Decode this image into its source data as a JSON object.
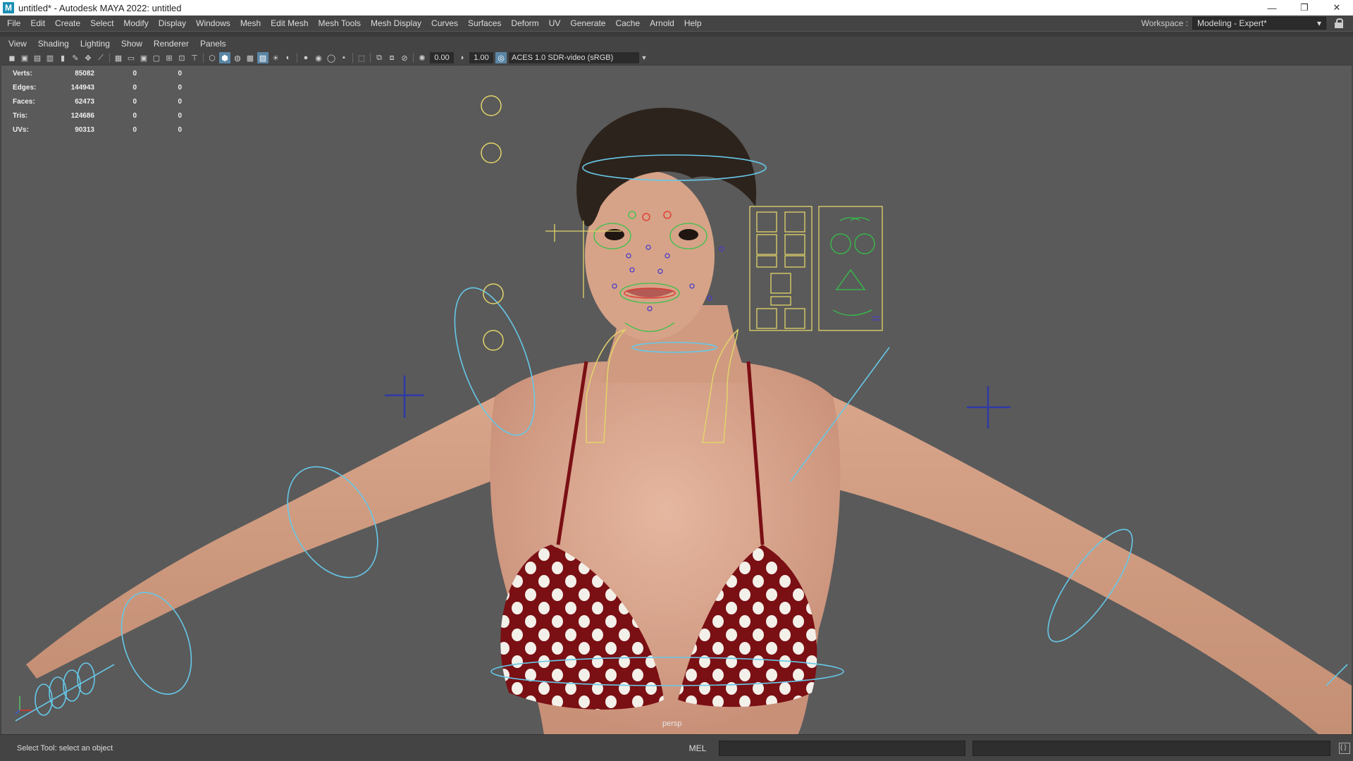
{
  "window": {
    "title": "untitled* - Autodesk MAYA 2022: untitled",
    "app_icon": "M",
    "minimize": "—",
    "maximize": "❐",
    "close": "✕"
  },
  "menubar": {
    "items": [
      "File",
      "Edit",
      "Create",
      "Select",
      "Modify",
      "Display",
      "Windows",
      "Mesh",
      "Edit Mesh",
      "Mesh Tools",
      "Mesh Display",
      "Curves",
      "Surfaces",
      "Deform",
      "UV",
      "Generate",
      "Cache",
      "Arnold",
      "Help"
    ],
    "workspace_label": "Workspace :",
    "workspace_value": "Modeling - Expert*"
  },
  "panel_menu": [
    "View",
    "Shading",
    "Lighting",
    "Show",
    "Renderer",
    "Panels"
  ],
  "toolbar": {
    "exposure": "0.00",
    "gamma": "1.00",
    "color_space": "ACES 1.0 SDR-video (sRGB)"
  },
  "hud": {
    "rows": [
      {
        "label": "Verts:",
        "v1": "85082",
        "v2": "0",
        "v3": "0"
      },
      {
        "label": "Edges:",
        "v1": "144943",
        "v2": "0",
        "v3": "0"
      },
      {
        "label": "Faces:",
        "v1": "62473",
        "v2": "0",
        "v3": "0"
      },
      {
        "label": "Tris:",
        "v1": "124686",
        "v2": "0",
        "v3": "0"
      },
      {
        "label": "UVs:",
        "v1": "90313",
        "v2": "0",
        "v3": "0"
      }
    ]
  },
  "viewport": {
    "camera": "persp",
    "background": "#5a5a5a",
    "control_color": "#66c8e8",
    "face_panel_color": "#e2d46a"
  },
  "statusbar": {
    "help_line": "Select Tool: select an object",
    "mel_label": "MEL"
  }
}
